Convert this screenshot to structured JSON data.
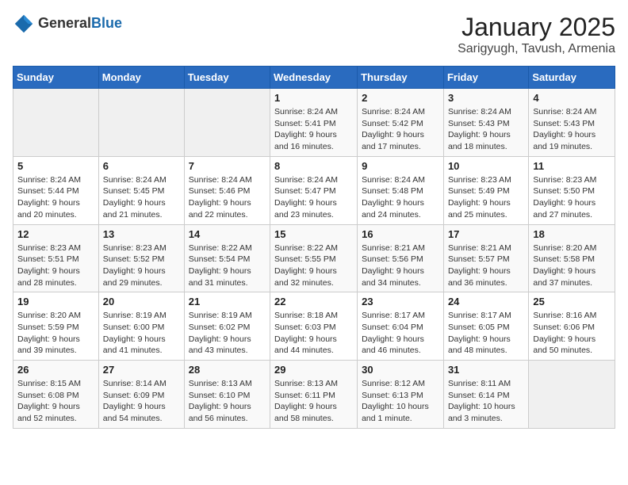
{
  "logo": {
    "general": "General",
    "blue": "Blue"
  },
  "header": {
    "month": "January 2025",
    "location": "Sarigyugh, Tavush, Armenia"
  },
  "days_of_week": [
    "Sunday",
    "Monday",
    "Tuesday",
    "Wednesday",
    "Thursday",
    "Friday",
    "Saturday"
  ],
  "weeks": [
    [
      {
        "day": "",
        "info": ""
      },
      {
        "day": "",
        "info": ""
      },
      {
        "day": "",
        "info": ""
      },
      {
        "day": "1",
        "info": "Sunrise: 8:24 AM\nSunset: 5:41 PM\nDaylight: 9 hours and 16 minutes."
      },
      {
        "day": "2",
        "info": "Sunrise: 8:24 AM\nSunset: 5:42 PM\nDaylight: 9 hours and 17 minutes."
      },
      {
        "day": "3",
        "info": "Sunrise: 8:24 AM\nSunset: 5:43 PM\nDaylight: 9 hours and 18 minutes."
      },
      {
        "day": "4",
        "info": "Sunrise: 8:24 AM\nSunset: 5:43 PM\nDaylight: 9 hours and 19 minutes."
      }
    ],
    [
      {
        "day": "5",
        "info": "Sunrise: 8:24 AM\nSunset: 5:44 PM\nDaylight: 9 hours and 20 minutes."
      },
      {
        "day": "6",
        "info": "Sunrise: 8:24 AM\nSunset: 5:45 PM\nDaylight: 9 hours and 21 minutes."
      },
      {
        "day": "7",
        "info": "Sunrise: 8:24 AM\nSunset: 5:46 PM\nDaylight: 9 hours and 22 minutes."
      },
      {
        "day": "8",
        "info": "Sunrise: 8:24 AM\nSunset: 5:47 PM\nDaylight: 9 hours and 23 minutes."
      },
      {
        "day": "9",
        "info": "Sunrise: 8:24 AM\nSunset: 5:48 PM\nDaylight: 9 hours and 24 minutes."
      },
      {
        "day": "10",
        "info": "Sunrise: 8:23 AM\nSunset: 5:49 PM\nDaylight: 9 hours and 25 minutes."
      },
      {
        "day": "11",
        "info": "Sunrise: 8:23 AM\nSunset: 5:50 PM\nDaylight: 9 hours and 27 minutes."
      }
    ],
    [
      {
        "day": "12",
        "info": "Sunrise: 8:23 AM\nSunset: 5:51 PM\nDaylight: 9 hours and 28 minutes."
      },
      {
        "day": "13",
        "info": "Sunrise: 8:23 AM\nSunset: 5:52 PM\nDaylight: 9 hours and 29 minutes."
      },
      {
        "day": "14",
        "info": "Sunrise: 8:22 AM\nSunset: 5:54 PM\nDaylight: 9 hours and 31 minutes."
      },
      {
        "day": "15",
        "info": "Sunrise: 8:22 AM\nSunset: 5:55 PM\nDaylight: 9 hours and 32 minutes."
      },
      {
        "day": "16",
        "info": "Sunrise: 8:21 AM\nSunset: 5:56 PM\nDaylight: 9 hours and 34 minutes."
      },
      {
        "day": "17",
        "info": "Sunrise: 8:21 AM\nSunset: 5:57 PM\nDaylight: 9 hours and 36 minutes."
      },
      {
        "day": "18",
        "info": "Sunrise: 8:20 AM\nSunset: 5:58 PM\nDaylight: 9 hours and 37 minutes."
      }
    ],
    [
      {
        "day": "19",
        "info": "Sunrise: 8:20 AM\nSunset: 5:59 PM\nDaylight: 9 hours and 39 minutes."
      },
      {
        "day": "20",
        "info": "Sunrise: 8:19 AM\nSunset: 6:00 PM\nDaylight: 9 hours and 41 minutes."
      },
      {
        "day": "21",
        "info": "Sunrise: 8:19 AM\nSunset: 6:02 PM\nDaylight: 9 hours and 43 minutes."
      },
      {
        "day": "22",
        "info": "Sunrise: 8:18 AM\nSunset: 6:03 PM\nDaylight: 9 hours and 44 minutes."
      },
      {
        "day": "23",
        "info": "Sunrise: 8:17 AM\nSunset: 6:04 PM\nDaylight: 9 hours and 46 minutes."
      },
      {
        "day": "24",
        "info": "Sunrise: 8:17 AM\nSunset: 6:05 PM\nDaylight: 9 hours and 48 minutes."
      },
      {
        "day": "25",
        "info": "Sunrise: 8:16 AM\nSunset: 6:06 PM\nDaylight: 9 hours and 50 minutes."
      }
    ],
    [
      {
        "day": "26",
        "info": "Sunrise: 8:15 AM\nSunset: 6:08 PM\nDaylight: 9 hours and 52 minutes."
      },
      {
        "day": "27",
        "info": "Sunrise: 8:14 AM\nSunset: 6:09 PM\nDaylight: 9 hours and 54 minutes."
      },
      {
        "day": "28",
        "info": "Sunrise: 8:13 AM\nSunset: 6:10 PM\nDaylight: 9 hours and 56 minutes."
      },
      {
        "day": "29",
        "info": "Sunrise: 8:13 AM\nSunset: 6:11 PM\nDaylight: 9 hours and 58 minutes."
      },
      {
        "day": "30",
        "info": "Sunrise: 8:12 AM\nSunset: 6:13 PM\nDaylight: 10 hours and 1 minute."
      },
      {
        "day": "31",
        "info": "Sunrise: 8:11 AM\nSunset: 6:14 PM\nDaylight: 10 hours and 3 minutes."
      },
      {
        "day": "",
        "info": ""
      }
    ]
  ]
}
